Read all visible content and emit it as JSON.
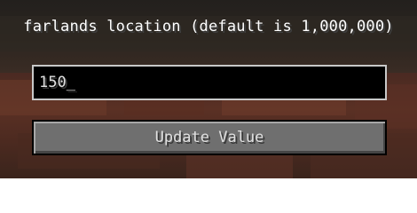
{
  "screen": {
    "title": "farlands location (default is 1,000,000)"
  },
  "input": {
    "value": "150",
    "cursor": "_"
  },
  "button": {
    "label": "Update Value"
  },
  "colors": {
    "text": "#e0e0e0",
    "input_bg": "#000000",
    "input_border": "#c8c8c8",
    "button_bg": "#6f6f6f"
  }
}
